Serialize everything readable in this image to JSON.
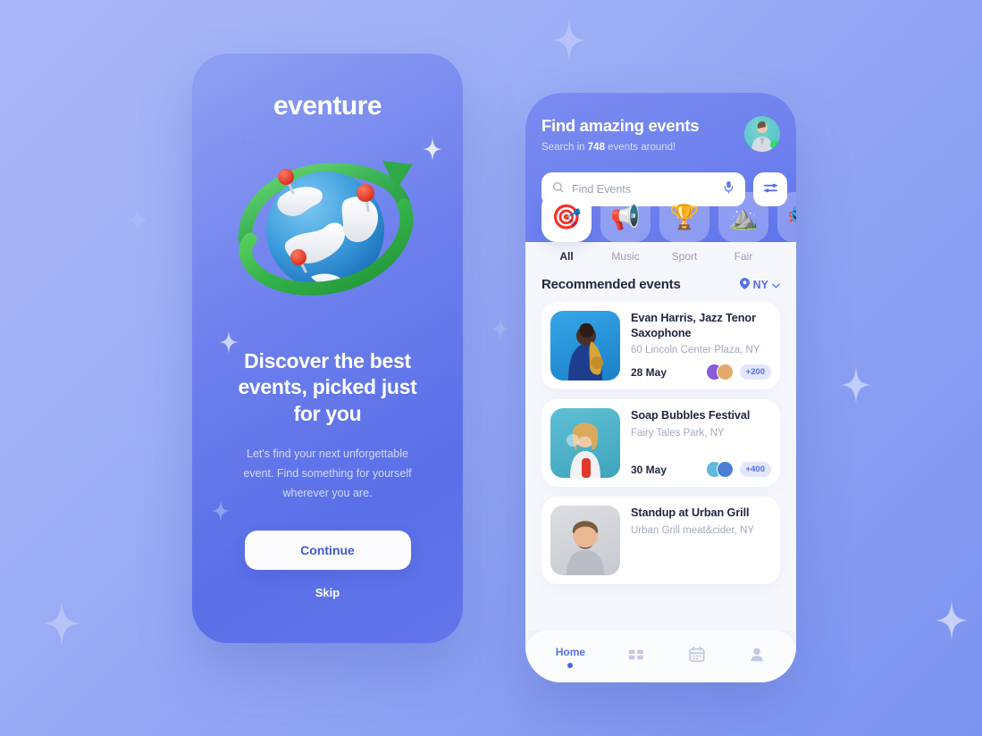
{
  "background": {
    "color_start": "#a9b7f7",
    "color_end": "#7c93f0"
  },
  "onboarding": {
    "app_title": "eventure",
    "illustration": "globe-orbit-pins-3d-illustration",
    "headline": "Discover the best events, picked just for you",
    "subtext": "Let's find your next unforgettable event. Find something for yourself wherever you are.",
    "continue_label": "Continue",
    "skip_label": "Skip",
    "accent": "#4257d8"
  },
  "events_app": {
    "header": {
      "title": "Find amazing events",
      "subtitle_prefix": "Search in ",
      "subtitle_count": "748",
      "subtitle_suffix": " events around!",
      "avatar": "user-avatar-photo",
      "status": "online"
    },
    "search": {
      "placeholder": "Find Events",
      "value": "",
      "mic_icon": "microphone-icon",
      "search_icon": "search-icon",
      "filter_icon": "filter-sliders-icon"
    },
    "categories": [
      {
        "label": "All",
        "emoji": "🎯",
        "active": true
      },
      {
        "label": "Music",
        "emoji": "📢",
        "active": false
      },
      {
        "label": "Sport",
        "emoji": "🏆",
        "active": false
      },
      {
        "label": "Fair",
        "emoji": "⛰️",
        "active": false
      },
      {
        "label": "",
        "emoji": "🎭",
        "active": false
      }
    ],
    "section": {
      "title": "Recommended events",
      "location": "NY",
      "location_icon": "map-pin-icon",
      "chevron_icon": "chevron-down-icon"
    },
    "events": [
      {
        "name": "Evan Harris, Jazz Tenor Saxophone",
        "place": "60 Lincoln Center Plaza, NY",
        "date": "28 May",
        "attendees_badge": "+200",
        "thumb": "saxophonist-photo",
        "thumb_color": "#2e9fe0"
      },
      {
        "name": "Soap Bubbles Festival",
        "place": "Fairy Tales Park, NY",
        "date": "30 May",
        "attendees_badge": "+400",
        "thumb": "woman-blowing-bubbles-photo",
        "thumb_color": "#53b6cc"
      },
      {
        "name": "Standup at Urban Grill",
        "place": "Urban Grill meat&cider, NY",
        "date": "",
        "attendees_badge": "",
        "thumb": "smiling-man-photo",
        "thumb_color": "#cfd2d8"
      }
    ],
    "nav": [
      {
        "label": "Home",
        "icon": "home-active-dot",
        "active": true
      },
      {
        "label": "",
        "icon": "grid-apps-icon",
        "active": false
      },
      {
        "label": "",
        "icon": "calendar-icon",
        "active": false
      },
      {
        "label": "",
        "icon": "person-icon",
        "active": false
      }
    ]
  }
}
